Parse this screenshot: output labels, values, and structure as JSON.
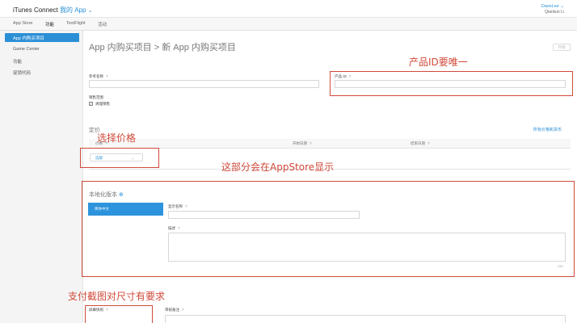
{
  "header": {
    "brand": "iTunes Connect",
    "app_label": "我的 App",
    "chevron": "⌄",
    "user_name": "DaveLee ⌄",
    "user_sub": "Qiankun Li"
  },
  "tabs": [
    "App Store",
    "功能",
    "TestFlight",
    "活动"
  ],
  "sidebar": {
    "items": [
      "App 内购买项目",
      "Game Center",
      "功能",
      "促销代码"
    ]
  },
  "breadcrumb": {
    "parent": "App 内购买项目",
    "separator": ">",
    "current": "新 App 内购买项目"
  },
  "save_label": "存储",
  "form": {
    "ref_name_label": "参考名称",
    "product_id_label": "产品 ID",
    "availability_label": "销售范围",
    "availability_checkbox": "清理销售",
    "help": "?"
  },
  "pricing": {
    "title": "定价",
    "link": "所有价格和货币",
    "col_price": "价格",
    "col_start": "开始日期",
    "col_end": "结束日期",
    "select_value": "选取",
    "caret": "⌄"
  },
  "localization": {
    "title": "本地化版本",
    "add_icon": "⊕",
    "language_tab": "简体中文",
    "display_name_label": "显示名称",
    "description_label": "描述",
    "counter": "255"
  },
  "review": {
    "screenshot_label": "屏幕快照",
    "notes_label": "审核备注"
  },
  "annotations": {
    "product_id": "产品ID要唯一",
    "price": "选择价格",
    "appstore_section": "这部分会在AppStore显示",
    "screenshot": "支付截图对尺寸有要求"
  },
  "colors": {
    "accent": "#2b8fd6",
    "annotation": "#d04a3a"
  }
}
